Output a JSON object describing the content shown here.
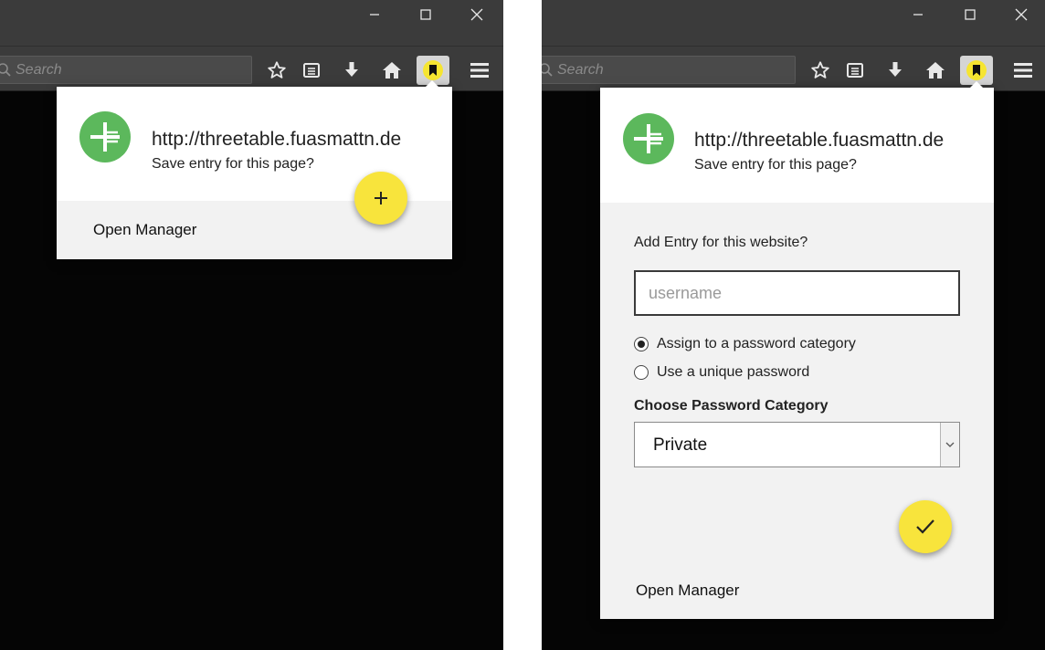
{
  "browser": {
    "search_placeholder": "Search"
  },
  "popup_collapsed": {
    "site_url": "http://threetable.fuasmattn.de",
    "prompt": "Save entry for this page?",
    "open_manager_label": "Open Manager"
  },
  "popup_expanded": {
    "site_url": "http://threetable.fuasmattn.de",
    "prompt": "Save entry for this page?",
    "form_title": "Add Entry for this website?",
    "username_placeholder": "username",
    "radio_options": [
      {
        "label": "Assign to a password category",
        "selected": true
      },
      {
        "label": "Use a unique password",
        "selected": false
      }
    ],
    "category_label": "Choose Password Category",
    "category_selected": "Private",
    "open_manager_label": "Open Manager"
  },
  "colors": {
    "accent_yellow": "#f8e43c",
    "logo_green": "#5cb85c",
    "toolbar_gray": "#3b3b3b"
  },
  "icons": [
    "minimize-icon",
    "maximize-icon",
    "close-icon",
    "search-icon",
    "star-icon",
    "reading-list-icon",
    "download-icon",
    "home-icon",
    "bookmark-extension-icon",
    "menu-icon",
    "fork-plus-logo-icon",
    "plus-icon",
    "check-icon",
    "chevron-down-icon"
  ]
}
